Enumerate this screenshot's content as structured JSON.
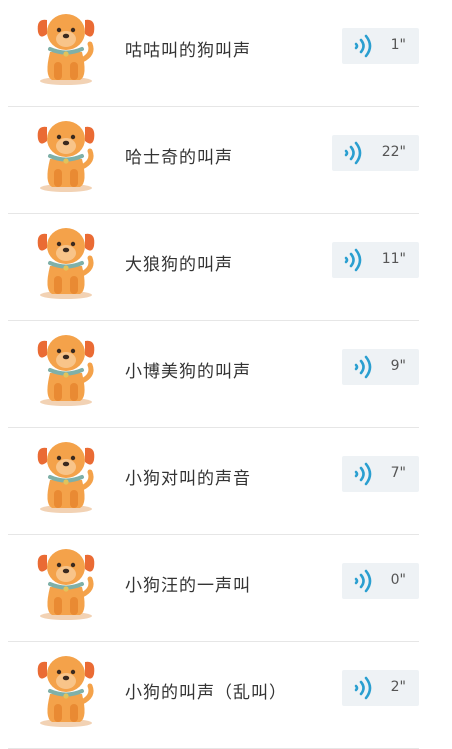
{
  "recordings": [
    {
      "title": "咕咕叫的狗叫声",
      "duration": "1\""
    },
    {
      "title": "哈士奇的叫声",
      "duration": "22\""
    },
    {
      "title": "大狼狗的叫声",
      "duration": "11\""
    },
    {
      "title": "小博美狗的叫声",
      "duration": "9\""
    },
    {
      "title": "小狗对叫的声音",
      "duration": "7\""
    },
    {
      "title": "小狗汪的一声叫",
      "duration": "0\""
    },
    {
      "title": "小狗的叫声（乱叫）",
      "duration": "2\""
    }
  ],
  "icons": {
    "thumbnail": "dog-icon",
    "play": "sound-wave-icon"
  },
  "colors": {
    "wave": "#2a9fd0",
    "voice_bg": "#eef2f5",
    "dog_body": "#f4a24a",
    "dog_ear": "#ea6b34",
    "collar": "#7fb0a8"
  }
}
